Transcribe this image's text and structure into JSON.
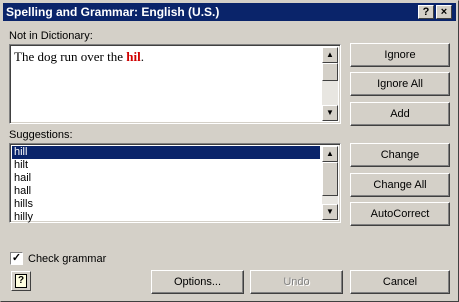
{
  "window": {
    "title": "Spelling and Grammar: English (U.S.)",
    "help_button": "?",
    "close_button": "×"
  },
  "not_in_dictionary": {
    "label": "Not in Dictionary:",
    "text_before": "The dog run over the ",
    "misspelled_word": "hil",
    "text_after": "."
  },
  "suggestions": {
    "label": "Suggestions:",
    "items": [
      "hill",
      "hilt",
      "hail",
      "hall",
      "hills",
      "hilly"
    ],
    "selected_index": 0
  },
  "buttons": {
    "ignore": "Ignore",
    "ignore_all": "Ignore All",
    "add": "Add",
    "change": "Change",
    "change_all": "Change All",
    "autocorrect": "AutoCorrect",
    "options": "Options...",
    "undo": "Undo",
    "cancel": "Cancel"
  },
  "check_grammar": {
    "label": "Check grammar",
    "checked": true,
    "mark": "✓"
  },
  "scroll_arrows": {
    "up": "▲",
    "down": "▼"
  },
  "help_icon_glyph": "?"
}
